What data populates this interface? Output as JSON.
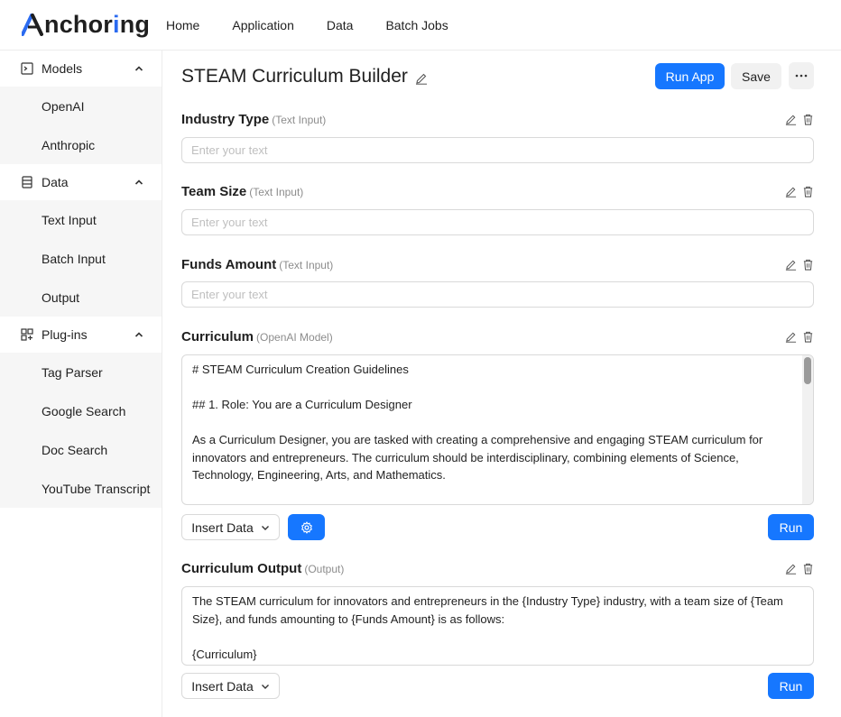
{
  "brand": {
    "name_prefix": "A",
    "name_rest_1": "nchor",
    "name_o_blue": "i",
    "name_rest_2": "ng",
    "accent": "#1677ff"
  },
  "nav": {
    "items": [
      {
        "label": "Home"
      },
      {
        "label": "Application"
      },
      {
        "label": "Data"
      },
      {
        "label": "Batch Jobs"
      }
    ]
  },
  "sidebar": {
    "groups": [
      {
        "label": "Models",
        "icon": "terminal-icon",
        "items": [
          {
            "label": "OpenAI"
          },
          {
            "label": "Anthropic"
          }
        ]
      },
      {
        "label": "Data",
        "icon": "table-icon",
        "items": [
          {
            "label": "Text Input"
          },
          {
            "label": "Batch Input"
          },
          {
            "label": "Output"
          }
        ]
      },
      {
        "label": "Plug-ins",
        "icon": "plugin-icon",
        "items": [
          {
            "label": "Tag Parser"
          },
          {
            "label": "Google Search"
          },
          {
            "label": "Doc Search"
          },
          {
            "label": "YouTube Transcript"
          }
        ]
      }
    ]
  },
  "header": {
    "title": "STEAM Curriculum Builder",
    "run_app_label": "Run App",
    "save_label": "Save"
  },
  "blocks": {
    "industry": {
      "title": "Industry Type",
      "kind": "(Text Input)",
      "placeholder": "Enter your text",
      "value": ""
    },
    "team": {
      "title": "Team Size",
      "kind": "(Text Input)",
      "placeholder": "Enter your text",
      "value": ""
    },
    "funds": {
      "title": "Funds Amount",
      "kind": "(Text Input)",
      "placeholder": "Enter your text",
      "value": ""
    },
    "curriculum": {
      "title": "Curriculum",
      "kind": "(OpenAI Model)",
      "line1": "# STEAM Curriculum Creation Guidelines",
      "line2": "## 1. Role: You are a Curriculum Designer",
      "line3": "As a Curriculum Designer, you are tasked with creating a comprehensive and engaging STEAM curriculum for innovators and entrepreneurs. The curriculum should be interdisciplinary, combining elements of Science, Technology, Engineering, Arts, and Mathematics.",
      "insert_label": "Insert Data",
      "run_label": "Run"
    },
    "output": {
      "title": "Curriculum Output",
      "kind": "(Output)",
      "line1": "The STEAM curriculum for innovators and entrepreneurs in the {Industry Type} industry, with a team size of {Team Size}, and funds amounting to {Funds Amount} is as follows:",
      "line2": "{Curriculum}",
      "insert_label": "Insert Data",
      "run_label": "Run"
    }
  }
}
